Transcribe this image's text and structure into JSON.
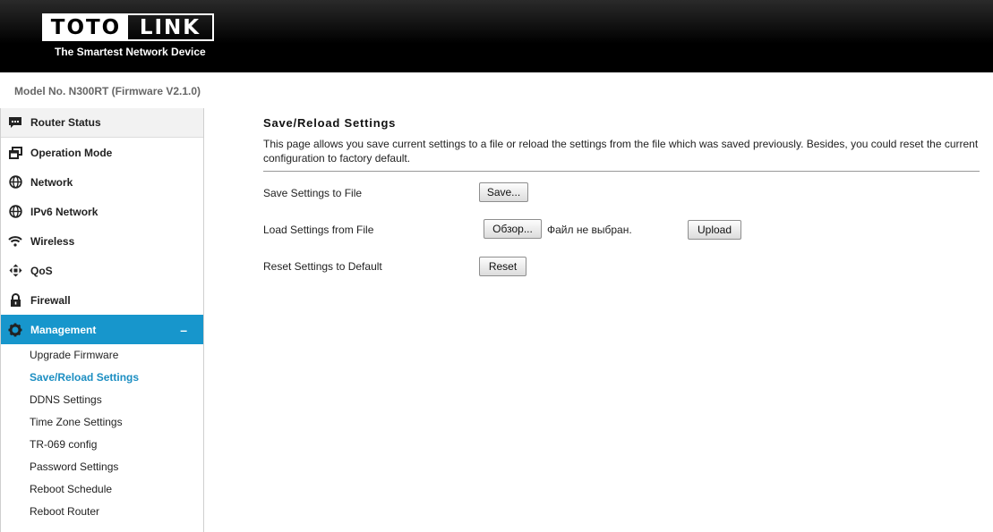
{
  "brand": {
    "logo_left": "TOTO",
    "logo_right": "LINK",
    "tagline": "The Smartest Network Device"
  },
  "model_text": "Model No. N300RT (Firmware V2.1.0)",
  "sidebar": {
    "items": [
      {
        "label": "Router Status",
        "icon": "chat-icon"
      },
      {
        "label": "Operation Mode",
        "icon": "windows-icon"
      },
      {
        "label": "Network",
        "icon": "globe-icon"
      },
      {
        "label": "IPv6 Network",
        "icon": "globe-icon"
      },
      {
        "label": "Wireless",
        "icon": "wifi-icon"
      },
      {
        "label": "QoS",
        "icon": "qos-arrows-icon"
      },
      {
        "label": "Firewall",
        "icon": "lock-icon"
      },
      {
        "label": "Management",
        "icon": "gear-icon",
        "expanded": true,
        "collapse_symbol": "–"
      }
    ],
    "sub_items": [
      "Upgrade Firmware",
      "Save/Reload Settings",
      "DDNS Settings",
      "Time Zone Settings",
      "TR-069 config",
      "Password Settings",
      "Reboot Schedule",
      "Reboot Router"
    ],
    "current_sub_item": "Save/Reload Settings"
  },
  "main": {
    "title": "Save/Reload Settings",
    "description": "This page allows you save current settings to a file or reload the settings from the file which was saved previously. Besides, you could reset the current configuration to factory default.",
    "rows": {
      "save": {
        "label": "Save Settings to File",
        "button": "Save..."
      },
      "load": {
        "label": "Load Settings from File",
        "browse_button": "Обзор...",
        "file_status": "Файл не выбран.",
        "upload_button": "Upload"
      },
      "reset": {
        "label": "Reset Settings to Default",
        "button": "Reset"
      }
    }
  },
  "colors": {
    "accent": "#1796cc",
    "current_link": "#1c8ec2",
    "header_bg": "#000000"
  }
}
